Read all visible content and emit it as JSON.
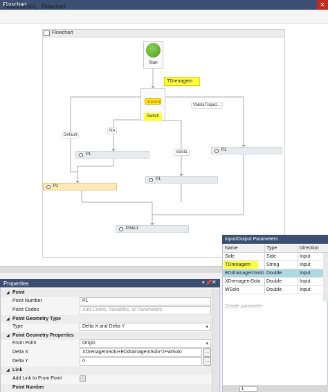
{
  "window": {
    "title": "Flowchart",
    "close_glyph": "✕"
  },
  "breadcrumb": {
    "items": [
      "Subassembly",
      "Flowchart"
    ],
    "separator": "›"
  },
  "flowchart": {
    "header_label": "Flowchart",
    "header_icon": "flowchart-icon",
    "start_label": "Start",
    "switch_label": "Switch",
    "switch_expression_tag": "TDrenagem",
    "edge_labels": {
      "default": "Default",
      "na": "NA",
      "valeta": "Valeta",
      "valeta_trap": "ValetaTrapez..."
    },
    "nodes": {
      "p1_a": "P1",
      "p1_b": "P1",
      "p1_c": "P1",
      "p1_d": "P1",
      "p2l1": "P2&L1"
    },
    "highlight_color": "#ffff40",
    "selected_node_color": "#fde9b5"
  },
  "properties": {
    "title": "Properties",
    "pin_glyph": "▾ 📌",
    "close_glyph": "✕",
    "sections": {
      "point": "Point",
      "geometry_type": "Point Geometry Type",
      "geometry_props": "Point Geometry Properties",
      "link": "Link",
      "point_number_section": "Point Number"
    },
    "rows": {
      "point_number": {
        "label": "Point Number",
        "value": "P1"
      },
      "point_codes": {
        "label": "Point Codes",
        "placeholder": "Add Codes, Variables, or Parameters"
      },
      "type": {
        "label": "Type",
        "value": "Delta X and Delta Y"
      },
      "from_point": {
        "label": "From Point",
        "value": "Origin"
      },
      "delta_x": {
        "label": "Delta X",
        "value": "XDrenagemSolo+EDdrainagemSolo*2+WSolo"
      },
      "delta_y": {
        "label": "Delta Y",
        "value": "0"
      },
      "add_link": {
        "label": "Add Link to From Point",
        "checked": false
      }
    },
    "ellipsis": "..."
  },
  "io_params": {
    "title": "Input/Output Parameters",
    "columns": [
      "Name",
      "Type",
      "Direction"
    ],
    "rows": [
      {
        "name": "Side",
        "type": "Side",
        "direction": "Input"
      },
      {
        "name": "TDrenagem",
        "type": "String",
        "direction": "Input"
      },
      {
        "name": "EDdrainagemSolo",
        "type": "Double",
        "direction": "Input"
      },
      {
        "name": "XDrenagemSolo",
        "type": "Double",
        "direction": "Input"
      },
      {
        "name": "WSolo",
        "type": "Double",
        "direction": "Input"
      }
    ],
    "create_placeholder": "Create parameter",
    "page_number": "1"
  }
}
